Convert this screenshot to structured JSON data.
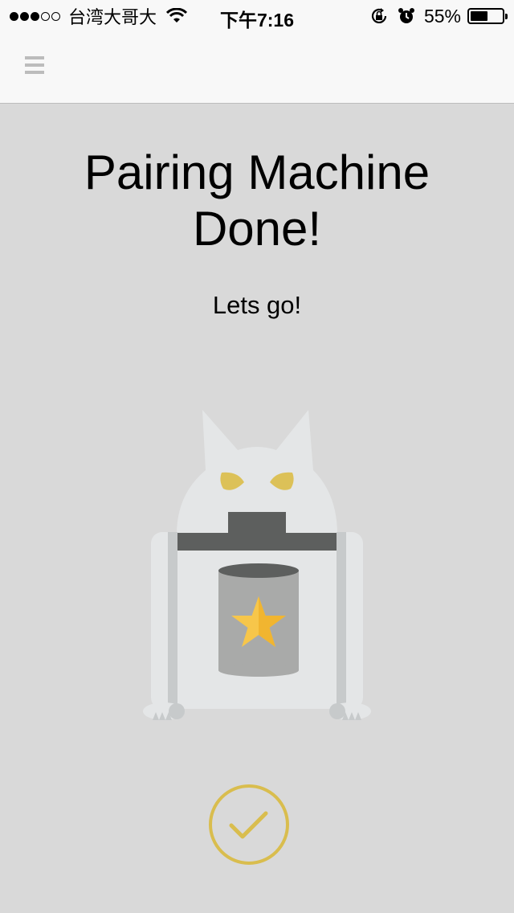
{
  "status_bar": {
    "carrier": "台湾大哥大",
    "time": "下午7:16",
    "battery_percent": "55%",
    "battery_level": 0.55,
    "signal_strength": 3,
    "signal_max": 5,
    "icons": [
      "signal-dots",
      "wifi-icon",
      "rotation-lock-icon",
      "alarm-icon",
      "battery-icon"
    ]
  },
  "nav": {
    "menu_icon": "hamburger-menu-icon"
  },
  "main": {
    "title": "Pairing Machine Done!",
    "subtitle": "Lets go!",
    "illustration": "cat-robot-with-star-can",
    "action_icon": "check-circle-icon"
  },
  "colors": {
    "background": "#d9d9d9",
    "bar_background": "#f8f8f8",
    "accent": "#d9bd4e",
    "cat_body": "#e4e6e7",
    "dark_gray": "#5d5f5e",
    "can_gray": "#a9aaa9",
    "star": "#f7c64a"
  }
}
